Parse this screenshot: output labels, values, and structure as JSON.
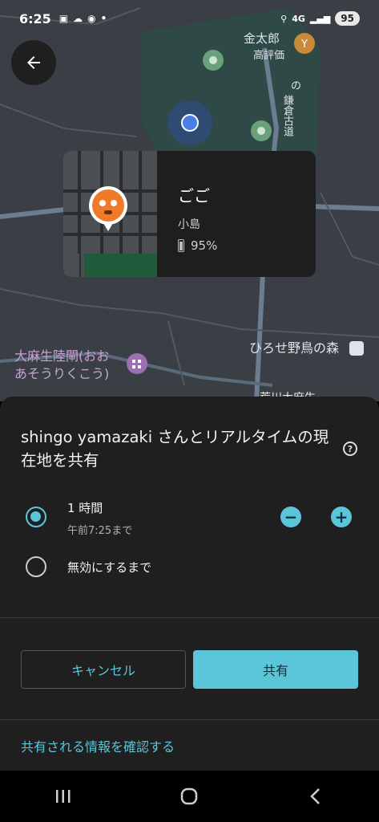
{
  "status_bar": {
    "time": "6:25",
    "network": "4G",
    "battery": "95"
  },
  "map": {
    "poi_kintaro": "金太郎",
    "poi_kintaro_sub": "高評価",
    "road_name": "鎌倉古道",
    "road_suffix": "の",
    "poi_forest": "ひろせ野鳥の森",
    "poi_lock_line1": "大麻生陸閘(おお",
    "poi_lock_line2": "あそうりくこう)",
    "poi_partial": "荒川大麻生"
  },
  "card": {
    "name": "ごご",
    "place": "小島",
    "battery": "95%"
  },
  "sheet": {
    "title": "shingo yamazaki さんとリアルタイムの現在地を共有",
    "option1_label": "1 時間",
    "option1_sub": "午前7:25まで",
    "option2_label": "無効にするまで",
    "minus": "−",
    "plus": "+",
    "cancel": "キャンセル",
    "share": "共有",
    "review_link": "共有される情報を確認する",
    "help": "?"
  },
  "colors": {
    "accent": "#5bc6d9",
    "sheet_bg": "#1f1f1f",
    "map_bg": "#3a3f45"
  }
}
